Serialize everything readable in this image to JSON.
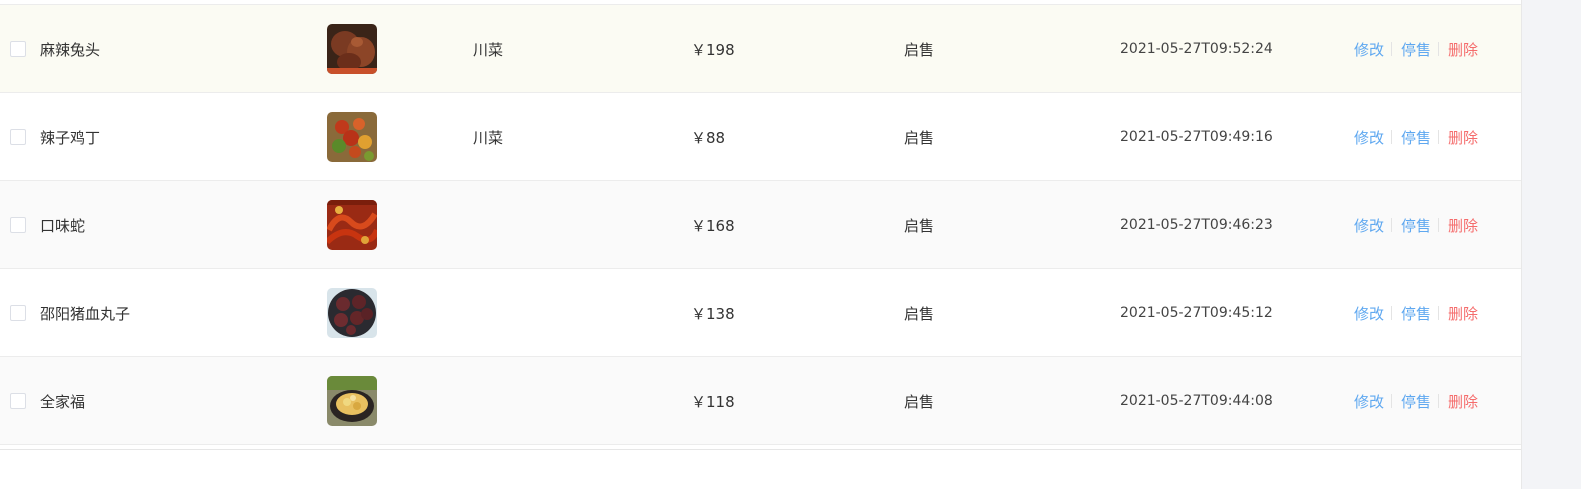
{
  "table": {
    "rows": [
      {
        "name": "麻辣兔头",
        "category": "川菜",
        "price": "￥198",
        "status": "启售",
        "updated": "2021-05-27T09:52:24",
        "image_icon": "dish-photo-rabbit-head"
      },
      {
        "name": "辣子鸡丁",
        "category": "川菜",
        "price": "￥88",
        "status": "启售",
        "updated": "2021-05-27T09:49:16",
        "image_icon": "dish-photo-spicy-chicken"
      },
      {
        "name": "口味蛇",
        "category": "",
        "price": "￥168",
        "status": "启售",
        "updated": "2021-05-27T09:46:23",
        "image_icon": "dish-photo-snake"
      },
      {
        "name": "邵阳猪血丸子",
        "category": "",
        "price": "￥138",
        "status": "启售",
        "updated": "2021-05-27T09:45:12",
        "image_icon": "dish-photo-blood-balls"
      },
      {
        "name": "全家福",
        "category": "",
        "price": "￥118",
        "status": "启售",
        "updated": "2021-05-27T09:44:08",
        "image_icon": "dish-photo-family-pot"
      }
    ],
    "actions": {
      "edit": "修改",
      "stop": "停售",
      "delete": "删除"
    }
  },
  "colors": {
    "link": "#5fa8f0",
    "danger": "#f56c6c",
    "hover_row": "#fbfbf3",
    "alt_row": "#fafafa"
  }
}
